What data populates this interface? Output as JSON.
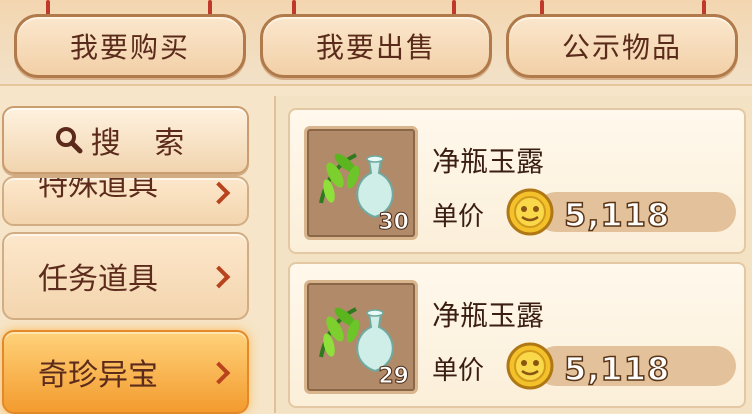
{
  "top_tabs": [
    {
      "label": "我要购买"
    },
    {
      "label": "我要出售"
    },
    {
      "label": "公示物品"
    }
  ],
  "sidebar": {
    "search_label": "搜 索",
    "items": [
      {
        "label": "特殊道具",
        "state": "partially-visible"
      },
      {
        "label": "任务道具"
      },
      {
        "label": "奇珍异宝",
        "state": "selected"
      }
    ]
  },
  "items": [
    {
      "name": "净瓶玉露",
      "price_label": "单价",
      "price": "5,118",
      "quantity": "30",
      "icon": "jade-vase-icon"
    },
    {
      "name": "净瓶玉露",
      "price_label": "单价",
      "price": "5,118",
      "quantity": "29",
      "icon": "jade-vase-icon"
    }
  ],
  "colors": {
    "accent": "#f39b2e",
    "text_dark": "#5a2b1b",
    "card_bg": "#fff8ec"
  }
}
